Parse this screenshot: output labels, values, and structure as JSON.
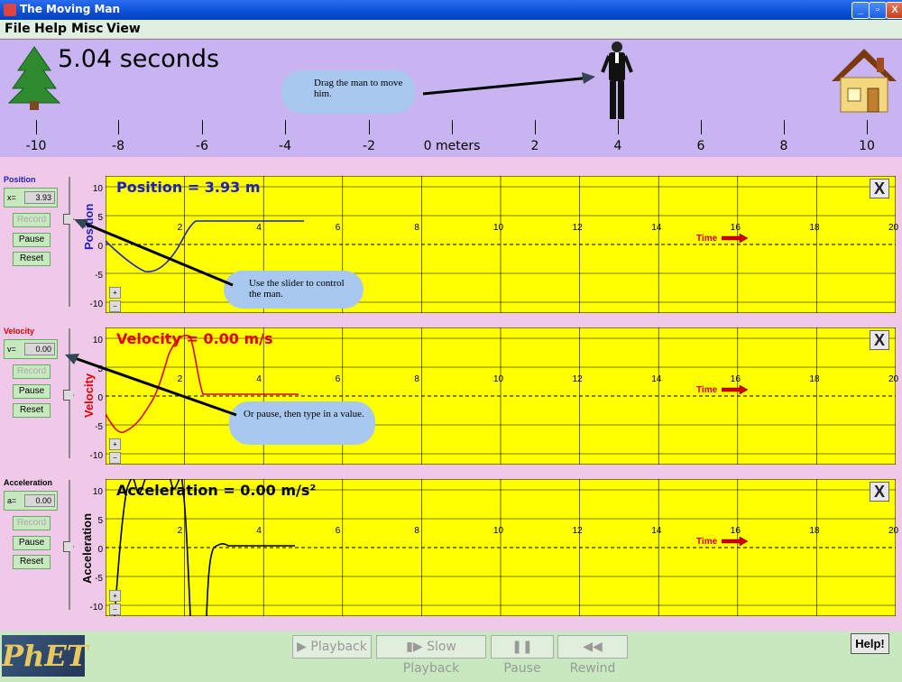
{
  "window": {
    "title": "The Moving Man",
    "buttons": [
      "_",
      "▫",
      "X"
    ]
  },
  "menu": [
    "File",
    "Help",
    "Misc",
    "View"
  ],
  "playarea": {
    "time_readout": "5.04 seconds",
    "ruler_labels": [
      "-10",
      "-8",
      "-6",
      "-4",
      "-2",
      "0 meters",
      "2",
      "4",
      "6",
      "8",
      "10"
    ],
    "hint_drag": "Drag the man to move him."
  },
  "hints": {
    "slider": "Use the slider to control the man.",
    "typein": "Or pause, then type in a value."
  },
  "graphs": [
    {
      "key": "position",
      "label": "Position",
      "prefix": "x=",
      "value": "3.93",
      "readout": "Position =  3.93 m",
      "ylabel": "Position",
      "color": "#2020c0"
    },
    {
      "key": "velocity",
      "label": "Velocity",
      "prefix": "v=",
      "value": "0.00",
      "readout": "Velocity =  0.00 m/s",
      "ylabel": "Velocity",
      "color": "#e00000"
    },
    {
      "key": "acceleration",
      "label": "Acceleration",
      "prefix": "a=",
      "value": "0.00",
      "readout": "Acceleration =  0.00 m/s²",
      "ylabel": "Acceleration",
      "color": "#000000"
    }
  ],
  "graph_controls": {
    "record": "Record",
    "pause": "Pause",
    "reset": "Reset"
  },
  "graph_axes": {
    "y_ticks": [
      "10",
      "5",
      "0",
      "-5",
      "-10"
    ],
    "x_ticks": [
      "2",
      "4",
      "6",
      "8",
      "10",
      "12",
      "14",
      "16",
      "18",
      "20"
    ],
    "time_label": "Time",
    "close_label": "X"
  },
  "playback": {
    "playback": "Playback",
    "slow": "Slow Playback",
    "pause": "Pause",
    "rewind": "Rewind"
  },
  "help": "Help!",
  "logo": "PhET",
  "colors": {
    "playarea": "#c8b4f0",
    "background": "#f0c8e8",
    "plot": "#ffff00",
    "bubble": "#a8c8f0",
    "controls": "#c8e8c0"
  }
}
